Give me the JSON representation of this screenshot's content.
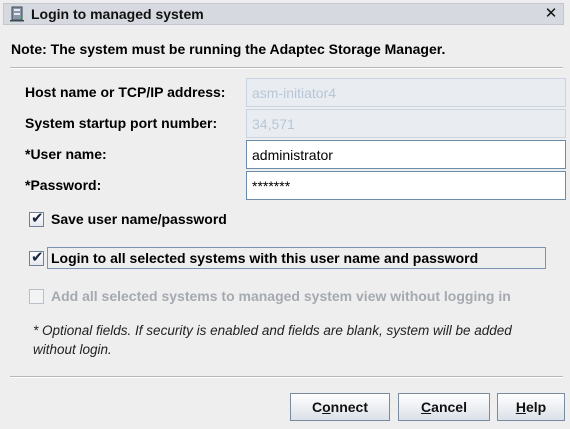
{
  "window": {
    "title": "Login to managed system",
    "title_icon": "server-icon",
    "close_glyph": "✕"
  },
  "note": "Note: The system must be running the Adaptec Storage Manager.",
  "form": {
    "host_label": "Host name or TCP/IP address:",
    "host_value": "asm-initiator4",
    "port_label": "System startup port number:",
    "port_value": "34,571",
    "user_label": "*User name:",
    "user_value": "administrator",
    "password_label": "*Password:",
    "password_value": "*******"
  },
  "options": {
    "save_label": "Save user name/password",
    "save_checked": true,
    "login_all_label": "Login to all selected systems with this user name and password",
    "login_all_checked": true,
    "add_all_label": "Add all selected systems to managed system view without logging in",
    "add_all_checked": false,
    "add_all_enabled": false
  },
  "footnote": "* Optional fields.  If security is enabled and fields are blank, system will be added without login.",
  "buttons": {
    "connect_pre": "C",
    "connect_mnemonic": "o",
    "connect_post": "nnect",
    "cancel_pre": "",
    "cancel_mnemonic": "C",
    "cancel_post": "ancel",
    "help_pre": "",
    "help_mnemonic": "H",
    "help_post": "elp"
  },
  "colors": {
    "dialog_bg": "#eeeeee",
    "titlebar_bg": "#d6d9df",
    "disabled_field_bg": "#e9edf2",
    "disabled_text": "#a5aab0"
  }
}
